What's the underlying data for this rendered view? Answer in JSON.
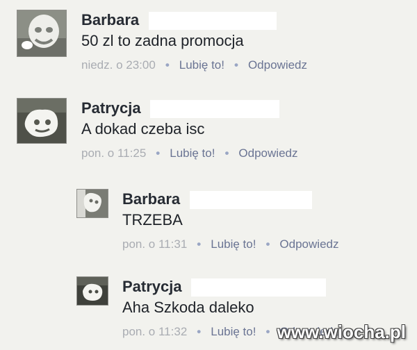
{
  "comments": [
    {
      "author": "Barbara",
      "text": "50 zl to zadna promocja",
      "time": "niedz. o 23:00",
      "like_label": "Lubię to!",
      "reply_label": "Odpowiedz",
      "separator": "•"
    },
    {
      "author": "Patrycja",
      "text": "A dokad czeba isc",
      "time": "pon. o 11:25",
      "like_label": "Lubię to!",
      "reply_label": "Odpowiedz",
      "separator": "•"
    },
    {
      "author": "Barbara",
      "text": "TRZEBA",
      "time": "pon. o 11:31",
      "like_label": "Lubię to!",
      "reply_label": "Odpowiedz",
      "separator": "•"
    },
    {
      "author": "Patrycja",
      "text": "Aha Szkoda daleko",
      "time": "pon. o 11:32",
      "like_label": "Lubię to!",
      "reply_label": "Odpowiedz",
      "separator": "•"
    }
  ],
  "watermark": "www.wiocha.pl",
  "colors": {
    "background": "#f2f2ee",
    "author": "#262b33",
    "text": "#1e2228",
    "meta": "#a5a8ae",
    "link": "#6a7493"
  }
}
